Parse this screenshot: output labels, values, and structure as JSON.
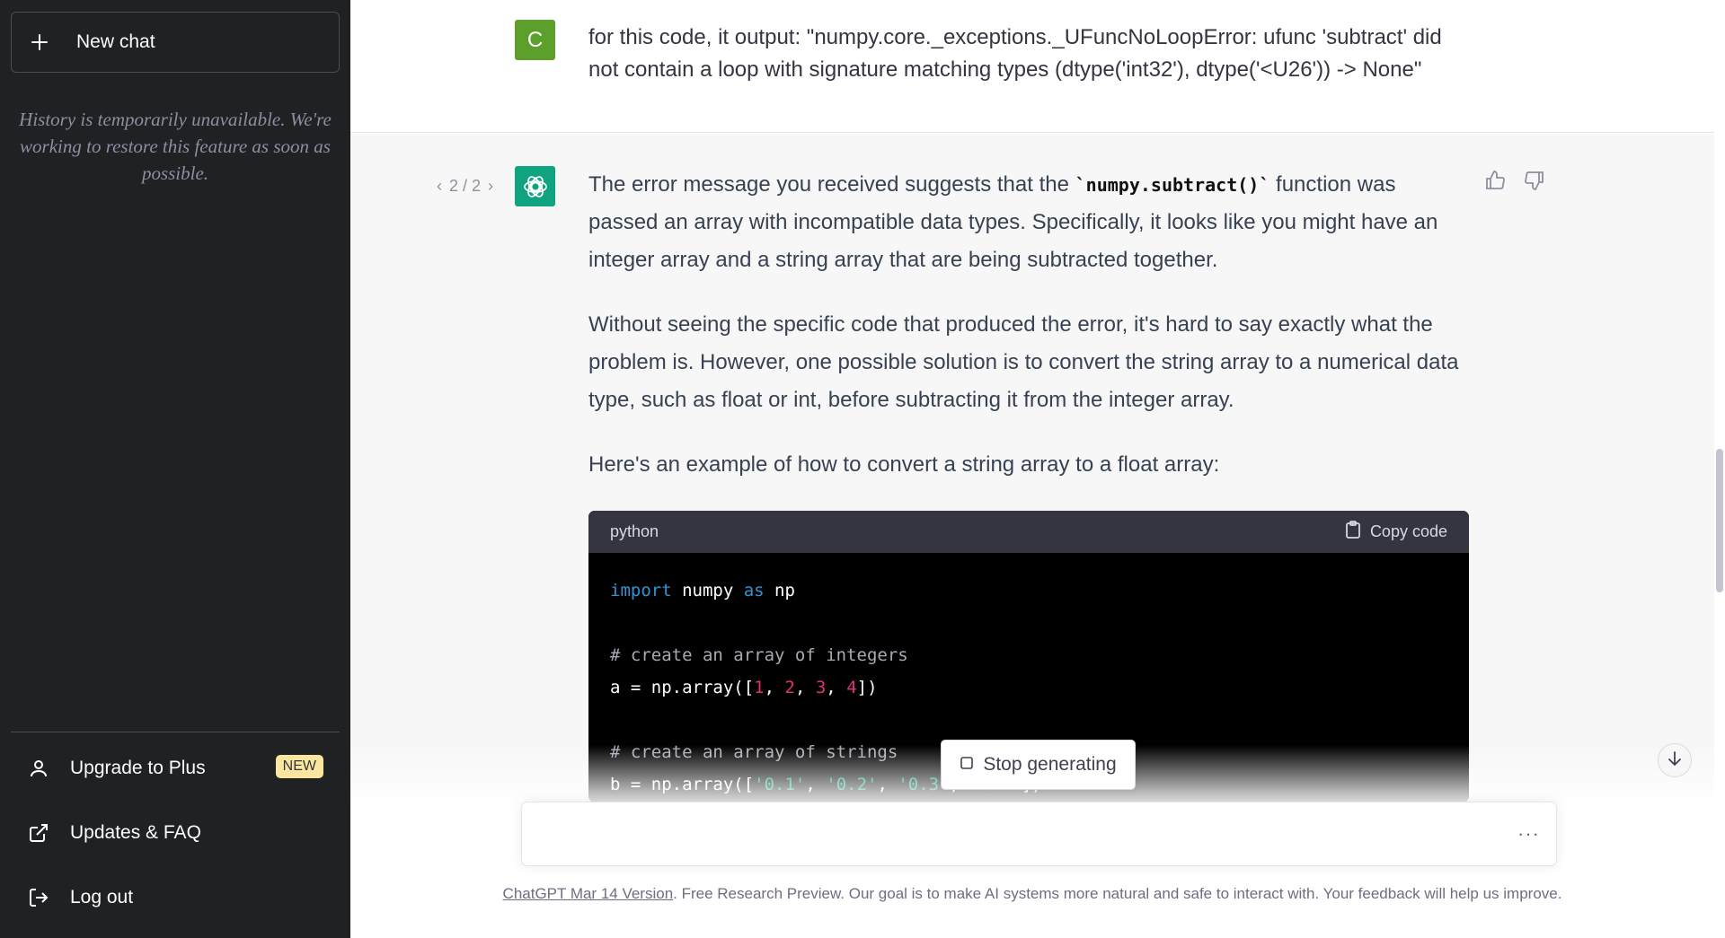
{
  "sidebar": {
    "new_chat_label": "New chat",
    "history_message": "History is temporarily unavailable. We're working to restore this feature as soon as possible.",
    "items": [
      {
        "label": "Upgrade to Plus",
        "badge": "NEW",
        "icon": "user-icon"
      },
      {
        "label": "Updates & FAQ",
        "icon": "external-link-icon"
      },
      {
        "label": "Log out",
        "icon": "logout-icon"
      }
    ]
  },
  "conversation": {
    "user_avatar_letter": "C",
    "user_message": "for this code, it output: \"numpy.core._exceptions._UFuncNoLoopError: ufunc 'subtract' did not contain a loop with signature matching types (dtype('int32'), dtype('<U26')) -> None\"",
    "pager": "2 / 2",
    "assistant": {
      "p1_before": "The error message you received suggests that the ",
      "p1_code": "`numpy.subtract()`",
      "p1_after": " function was passed an array with incompatible data types. Specifically, it looks like you might have an integer array and a string array that are being subtracted together.",
      "p2": "Without seeing the specific code that produced the error, it's hard to say exactly what the problem is. However, one possible solution is to convert the string array to a numerical data type, such as float or int, before subtracting it from the integer array.",
      "p3": "Here's an example of how to convert a string array to a float array:"
    },
    "code": {
      "language": "python",
      "copy_label": "Copy code"
    }
  },
  "controls": {
    "stop_label": "Stop generating",
    "input_placeholder": "",
    "more_dots": "···"
  },
  "footer": {
    "version_link": "ChatGPT Mar 14 Version",
    "text": ". Free Research Preview. Our goal is to make AI systems more natural and safe to interact with. Your feedback will help us improve."
  },
  "colors": {
    "sidebar_bg": "#202123",
    "user_avatar": "#5c9f2a",
    "gpt_avatar": "#10a37f",
    "badge_bg": "#fae69e"
  }
}
